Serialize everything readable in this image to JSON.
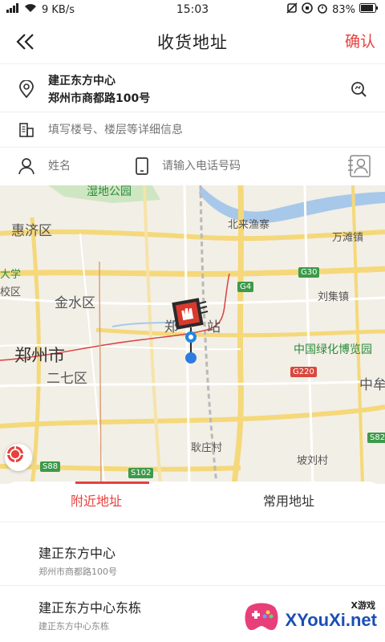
{
  "status_bar": {
    "signal_text": "9 KB/s",
    "time": "15:03",
    "battery": "83%"
  },
  "nav": {
    "title": "收货地址",
    "confirm_label": "确认"
  },
  "address": {
    "name": "建正东方中心",
    "street": "郑州市商都路100号"
  },
  "detail": {
    "placeholder": "填写楼号、楼层等详细信息"
  },
  "contact": {
    "name_placeholder": "姓名",
    "phone_placeholder": "请输入电话号码"
  },
  "map": {
    "labels": {
      "park": "湿地公园",
      "huiji": "惠济区",
      "beilai": "北来渔寨",
      "wanshan": "万滩镇",
      "daxue": "大学",
      "jiaoqu": "校区",
      "jinshui": "金水区",
      "liuji": "刘集镇",
      "zheng_station": "郑",
      "zhan": "站",
      "museum": "中国绿化博览园",
      "zhengzhou": "郑州市",
      "erqi": "二七区",
      "zhongmou": "中牟",
      "genzhuang": "耿庄村",
      "peilu": "坡刘村"
    },
    "road_signs": {
      "g4": "G4",
      "g30": "G30",
      "g220": "G220",
      "s82": "S82",
      "s88": "S88",
      "s102": "S102"
    }
  },
  "tabs": [
    {
      "label": "附近地址",
      "active": true
    },
    {
      "label": "常用地址",
      "active": false
    }
  ],
  "results": [
    {
      "title": "建正东方中心",
      "subtitle": "郑州市商都路100号"
    },
    {
      "title": "建正东方中心东栋",
      "subtitle": "建正东方中心东栋"
    }
  ],
  "watermark": {
    "small": "X游戏",
    "big": "XYouXi.net"
  },
  "colors": {
    "accent": "#e8403c",
    "map_bg": "#f2efe6",
    "road_yellow": "#f5d87a",
    "water": "#a8c8ea"
  }
}
